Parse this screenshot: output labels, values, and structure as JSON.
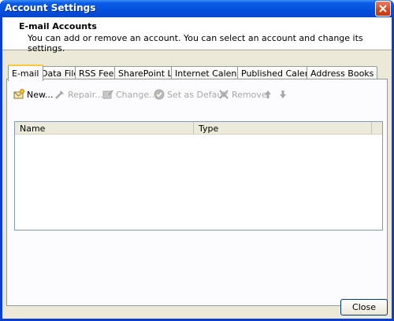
{
  "window": {
    "title": "Account Settings"
  },
  "header": {
    "title": "E-mail Accounts",
    "description": "You can add or remove an account. You can select an account and change its settings."
  },
  "tabs": [
    {
      "label": "E-mail",
      "active": true
    },
    {
      "label": "Data Files"
    },
    {
      "label": "RSS Feeds"
    },
    {
      "label": "SharePoint Lists"
    },
    {
      "label": "Internet Calendars"
    },
    {
      "label": "Published Calendars"
    },
    {
      "label": "Address Books"
    }
  ],
  "toolbar": {
    "new_label": "New...",
    "repair_label": "Repair...",
    "change_label": "Change...",
    "default_label": "Set as Default",
    "remove_label": "Remove"
  },
  "list": {
    "columns": [
      "Name",
      "Type"
    ]
  },
  "footer": {
    "close_label": "Close"
  },
  "colors": {
    "titlebar": "#0451dd",
    "dialog_bg": "#ece9d8",
    "active_tab_accent": "#ffc83c"
  }
}
